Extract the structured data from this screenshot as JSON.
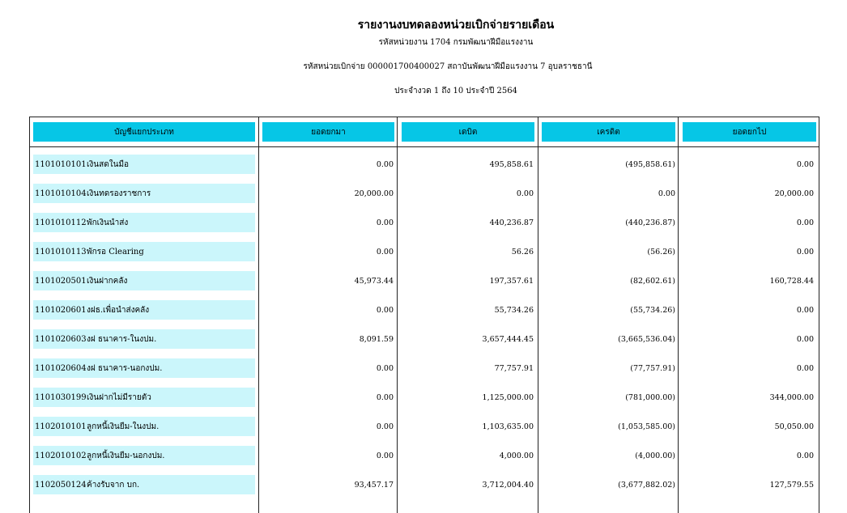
{
  "report": {
    "title": "รายงานงบทดลองหน่วยเบิกจ่ายรายเดือน",
    "agency_line": "รหัสหน่วยงาน 1704 กรมพัฒนาฝีมือแรงงาน",
    "disburse_line": "รหัสหน่วยเบิกจ่าย 000001700400027 สถาบันพัฒนาฝีมือแรงงาน 7 อุบลราชธานี",
    "period_line": "ประจำงวด 1 ถึง 10 ประจำปี 2564"
  },
  "table": {
    "columns": [
      "บัญชีแยกประเภท",
      "ยอดยกมา",
      "เดบิต",
      "เครดิต",
      "ยอดยกไป"
    ],
    "rows": [
      {
        "code": "1101010101",
        "name": "เงินสดในมือ",
        "brought_forward": "0.00",
        "debit": "495,858.61",
        "credit": "(495,858.61)",
        "carried_forward": "0.00"
      },
      {
        "code": "1101010104",
        "name": "เงินทดรองราชการ",
        "brought_forward": "20,000.00",
        "debit": "0.00",
        "credit": "0.00",
        "carried_forward": "20,000.00"
      },
      {
        "code": "1101010112",
        "name": "พักเงินนำส่ง",
        "brought_forward": "0.00",
        "debit": "440,236.87",
        "credit": "(440,236.87)",
        "carried_forward": "0.00"
      },
      {
        "code": "1101010113",
        "name": "พักรอ Clearing",
        "brought_forward": "0.00",
        "debit": "56.26",
        "credit": "(56.26)",
        "carried_forward": "0.00"
      },
      {
        "code": "1101020501",
        "name": "เงินฝากคลัง",
        "brought_forward": "45,973.44",
        "debit": "197,357.61",
        "credit": "(82,602.61)",
        "carried_forward": "160,728.44"
      },
      {
        "code": "1101020601",
        "name": "งฝธ.เพื่อนำส่งคลัง",
        "brought_forward": "0.00",
        "debit": "55,734.26",
        "credit": "(55,734.26)",
        "carried_forward": "0.00"
      },
      {
        "code": "1101020603",
        "name": "งฝ ธนาคาร-ในงปม.",
        "brought_forward": "8,091.59",
        "debit": "3,657,444.45",
        "credit": "(3,665,536.04)",
        "carried_forward": "0.00"
      },
      {
        "code": "1101020604",
        "name": "งฝ ธนาคาร-นอกงปม.",
        "brought_forward": "0.00",
        "debit": "77,757.91",
        "credit": "(77,757.91)",
        "carried_forward": "0.00"
      },
      {
        "code": "1101030199",
        "name": "เงินฝากไม่มีรายตัว",
        "brought_forward": "0.00",
        "debit": "1,125,000.00",
        "credit": "(781,000.00)",
        "carried_forward": "344,000.00"
      },
      {
        "code": "1102010101",
        "name": "ลูกหนี้เงินยืม-ในงปม.",
        "brought_forward": "0.00",
        "debit": "1,103,635.00",
        "credit": "(1,053,585.00)",
        "carried_forward": "50,050.00"
      },
      {
        "code": "1102010102",
        "name": "ลูกหนี้เงินยืม-นอกงปม.",
        "brought_forward": "0.00",
        "debit": "4,000.00",
        "credit": "(4,000.00)",
        "carried_forward": "0.00"
      },
      {
        "code": "1102050124",
        "name": "ค้างรับจาก บก.",
        "brought_forward": "93,457.17",
        "debit": "3,712,004.40",
        "credit": "(3,677,882.02)",
        "carried_forward": "127,579.55"
      }
    ]
  },
  "colors": {
    "header_bg": "#06c6e6",
    "account_bg": "#cbf6fb"
  }
}
